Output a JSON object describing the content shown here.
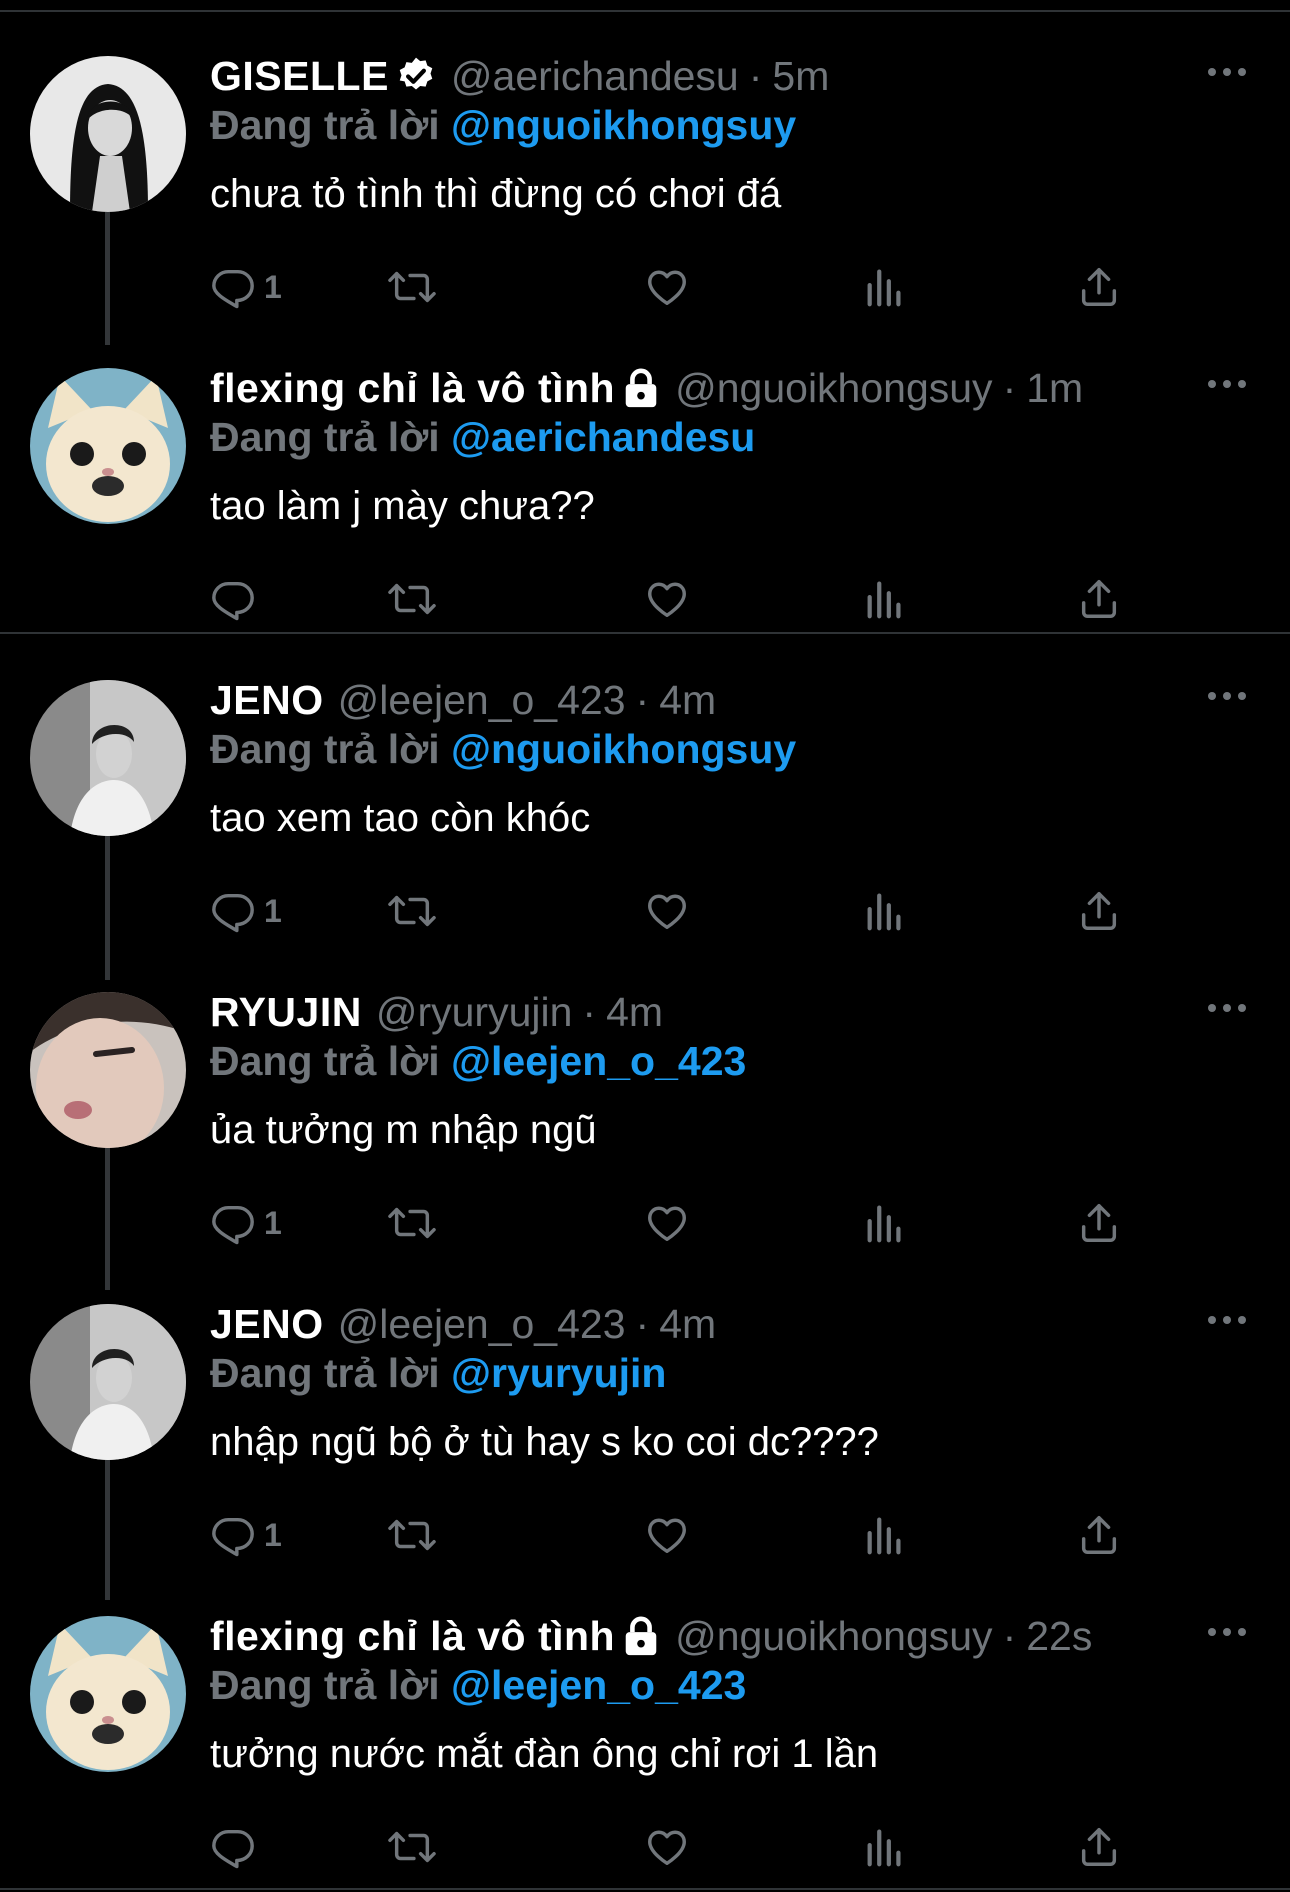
{
  "colors": {
    "background": "#000000",
    "text": "#e7e9ea",
    "muted": "#71767b",
    "accent": "#1d9bf0",
    "divider": "#2f3336"
  },
  "reply_label": "Đang trả lời",
  "tweets": [
    {
      "name": "GISELLE",
      "badge": "verified-icon",
      "handle": "@aerichandesu",
      "time": "5m",
      "reply_to": "@nguoikhongsuy",
      "text": "chưa tỏ tình thì đừng có chơi đá",
      "reply_count": "1",
      "avatar": "avatar-giselle"
    },
    {
      "name": "flexing chỉ là vô tình",
      "badge": "lock-icon",
      "handle": "@nguoikhongsuy",
      "time": "1m",
      "reply_to": "@aerichandesu",
      "text": "tao làm j mày chưa??",
      "reply_count": "",
      "avatar": "avatar-cat"
    },
    {
      "name": "JENO",
      "badge": "",
      "handle": "@leejen_o_423",
      "time": "4m",
      "reply_to": "@nguoikhongsuy",
      "text": "tao xem tao còn khóc",
      "reply_count": "1",
      "avatar": "avatar-jeno"
    },
    {
      "name": "RYUJIN",
      "badge": "",
      "handle": "@ryuryujin",
      "time": "4m",
      "reply_to": "@leejen_o_423",
      "text": "ủa tưởng m nhập ngũ",
      "reply_count": "1",
      "avatar": "avatar-ryujin"
    },
    {
      "name": "JENO",
      "badge": "",
      "handle": "@leejen_o_423",
      "time": "4m",
      "reply_to": "@ryuryujin",
      "text": "nhập ngũ bộ ở tù hay s ko coi dc????",
      "reply_count": "1",
      "avatar": "avatar-jeno"
    },
    {
      "name": "flexing chỉ là vô tình",
      "badge": "lock-icon",
      "handle": "@nguoikhongsuy",
      "time": "22s",
      "reply_to": "@leejen_o_423",
      "text": "tưởng nước mắt đàn ông chỉ rơi 1 lần",
      "reply_count": "",
      "avatar": "avatar-cat"
    }
  ]
}
